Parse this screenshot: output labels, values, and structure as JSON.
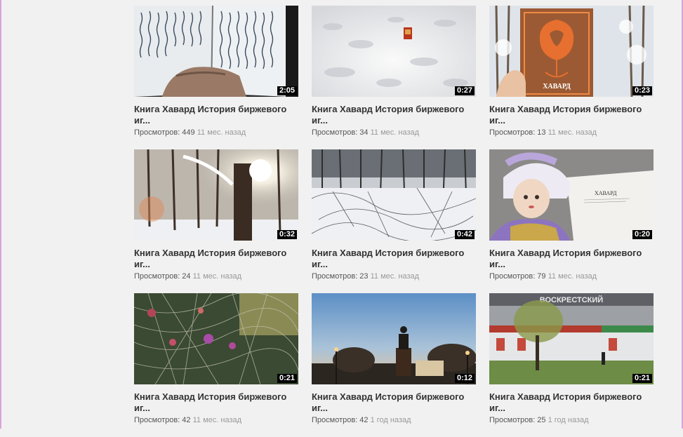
{
  "videos": [
    {
      "title": "Книга Хавард История биржевого иг...",
      "views_label": "Просмотров: 449",
      "ago": "11 мес. назад",
      "duration": "2:05",
      "thumb_icon": "book-pages-thumbnail"
    },
    {
      "title": "Книга Хавард История биржевого иг...",
      "views_label": "Просмотров: 34",
      "ago": "11 мес. назад",
      "duration": "0:27",
      "thumb_icon": "book-in-snow-thumbnail"
    },
    {
      "title": "Книга Хавард История биржевого иг...",
      "views_label": "Просмотров: 13",
      "ago": "11 мес. назад",
      "duration": "0:23",
      "thumb_icon": "book-cover-thumbnail",
      "cover_text": "ХАВАРД"
    },
    {
      "title": "Книга Хавард История биржевого иг...",
      "views_label": "Просмотров: 24",
      "ago": "11 мес. назад",
      "duration": "0:32",
      "thumb_icon": "winter-sun-forest-thumbnail"
    },
    {
      "title": "Книга Хавард История биржевого иг...",
      "views_label": "Просмотров: 23",
      "ago": "11 мес. назад",
      "duration": "0:42",
      "thumb_icon": "snowy-forest-thumbnail"
    },
    {
      "title": "Книга Хавард История биржевого иг...",
      "views_label": "Просмотров: 79",
      "ago": "11 мес. назад",
      "duration": "0:20",
      "thumb_icon": "doll-and-book-thumbnail",
      "book_text": "ХАВАРД"
    },
    {
      "title": "Книга Хавард История биржевого иг...",
      "views_label": "Просмотров: 42",
      "ago": "11 мес. назад",
      "duration": "0:21",
      "thumb_icon": "christmas-tree-thumbnail"
    },
    {
      "title": "Книга Хавард История биржевого иг...",
      "views_label": "Просмотров: 42",
      "ago": "1 год назад",
      "duration": "0:12",
      "thumb_icon": "monument-dusk-thumbnail"
    },
    {
      "title": "Книга Хавард История биржевого иг...",
      "views_label": "Просмотров: 25",
      "ago": "1 год назад",
      "duration": "0:21",
      "thumb_icon": "storefront-thumbnail",
      "sign_text": "ВОСКРЕСТСКИЙ"
    }
  ]
}
